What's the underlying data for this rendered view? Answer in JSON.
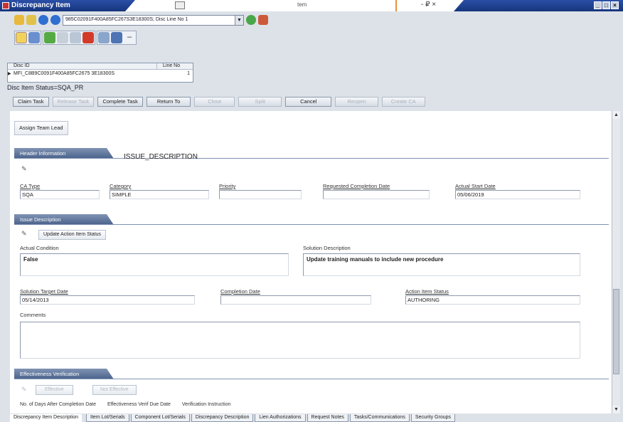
{
  "window": {
    "title": "Discrepancy Item",
    "center_text": "tem",
    "title_controls": "- ₽ ×",
    "win_buttons": [
      "_",
      "□",
      "×"
    ]
  },
  "toolbar": {
    "record_combo_value": "985C02091F400A85FC267S3E18300S; Disc Line No 1"
  },
  "disc_table": {
    "headers": [
      "Disc ID",
      "Line No"
    ],
    "row": {
      "id": "MFI_C8B9C0091F400A85FC2675 3E18300S",
      "line_no": "1"
    }
  },
  "status_line": "Disc Item Status=SQA_PR",
  "actions": [
    {
      "label": "Claim Task",
      "enabled": true
    },
    {
      "label": "Release Task",
      "enabled": false
    },
    {
      "label": "Complete Task",
      "enabled": true
    },
    {
      "label": "Return To",
      "enabled": true
    },
    {
      "label": "Close",
      "enabled": false
    },
    {
      "label": "Split",
      "enabled": false
    },
    {
      "label": "Cancel",
      "enabled": true
    },
    {
      "label": "Reopen",
      "enabled": false
    },
    {
      "label": "Create CA",
      "enabled": false
    }
  ],
  "main": {
    "assign_btn": "Assign Team Lead",
    "header_section": {
      "label": "Header Information",
      "title": "ISSUE_DESCRIPTION",
      "fields": {
        "ca_type": {
          "label": "CA Type",
          "value": "SQA"
        },
        "category": {
          "label": "Category",
          "value": "SIMPLE"
        },
        "priority": {
          "label": "Priority",
          "value": ""
        },
        "req_completion": {
          "label": "Requested Completion Date",
          "value": ""
        },
        "actual_start": {
          "label": "Actual Start Date",
          "value": "05/06/2019"
        }
      }
    },
    "issue_section": {
      "label": "Issue Description",
      "update_btn": "Update Action Item Status",
      "actual_condition_label": "Actual Condition",
      "actual_condition_value": "False",
      "solution_desc_label": "Solution Description",
      "solution_desc_value": "Update training manuals to include new procedure",
      "solution_target": {
        "label": "Solution Target Date",
        "value": "05/14/2013"
      },
      "completion_date": {
        "label": "Completion Date",
        "value": ""
      },
      "action_status": {
        "label": "Action Item Status",
        "value": "AUTHORING"
      },
      "comments_label": "Comments"
    },
    "effectiveness_section": {
      "label": "Effectiveness Verification",
      "btn_effective": "Effective",
      "btn_not_effective": "Not Effective",
      "partial_labels": [
        "No. of Days After Completion Date",
        "Effectiveness Verif Due Date",
        "Verification Instruction"
      ]
    }
  },
  "tabs": [
    "Discrepancy Item Description",
    "Item Lot/Serials",
    "Component Lot/Serials",
    "Discrepancy Description",
    "Lien Authorizations",
    "Request Notes",
    "Tasks/Communications",
    "Security Groups"
  ]
}
